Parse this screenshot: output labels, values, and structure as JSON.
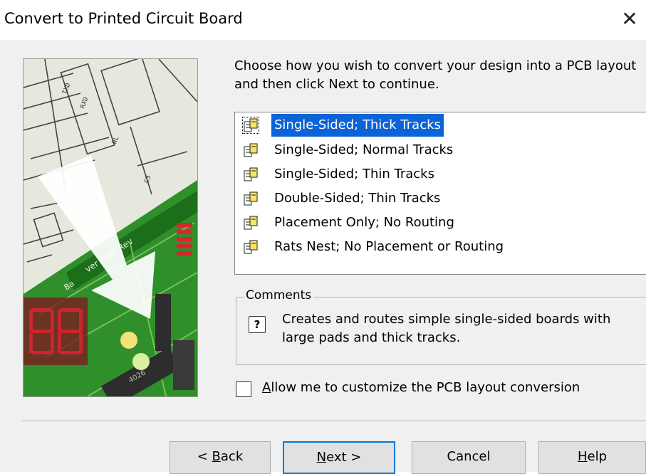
{
  "window": {
    "title": "Convert to Printed Circuit Board",
    "close_glyph": "✕"
  },
  "instructions": "Choose how you wish to convert your design into a PCB layout and then click Next to continue.",
  "options": [
    {
      "label": "Single-Sided; Thick Tracks",
      "selected": true
    },
    {
      "label": "Single-Sided; Normal Tracks",
      "selected": false
    },
    {
      "label": "Single-Sided; Thin Tracks",
      "selected": false
    },
    {
      "label": "Double-Sided; Thin Tracks",
      "selected": false
    },
    {
      "label": "Placement Only; No Routing",
      "selected": false
    },
    {
      "label": "Rats Nest; No Placement or Routing",
      "selected": false
    }
  ],
  "comments": {
    "legend": "Comments",
    "icon": "help-icon",
    "text": "Creates and routes simple single-sided boards with large pads and thick tracks."
  },
  "customize": {
    "checked": false,
    "label_first": "A",
    "label_rest": "llow me to customize the PCB layout conversion"
  },
  "buttons": {
    "back": {
      "pre": "< ",
      "key": "B",
      "post": "ack"
    },
    "next": {
      "key": "N",
      "post": "ext >"
    },
    "cancel": "Cancel",
    "help": {
      "key": "H",
      "post": "elp"
    }
  },
  "art_labels": {
    "board_title": "ver PCB, Rev",
    "board_label": "Ba",
    "chip": "4026"
  },
  "colors": {
    "selection": "#0a64d8",
    "default_button_border": "#0078d7",
    "dialog_bg": "#f0f0f0"
  }
}
